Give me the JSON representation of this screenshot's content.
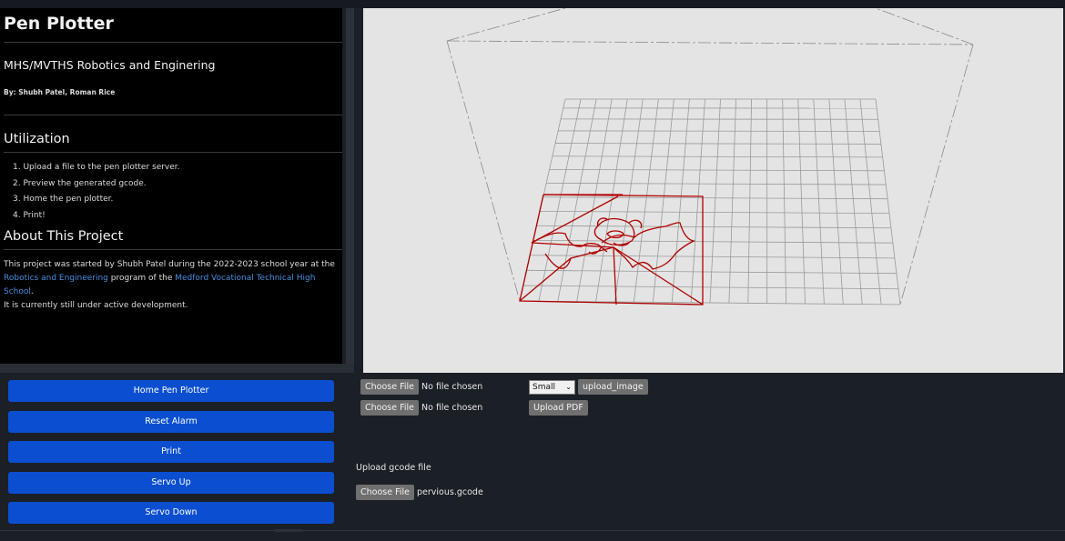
{
  "sidebar": {
    "title": "Pen Plotter",
    "subtitle": "MHS/MVTHS Robotics and Enginering",
    "byline": "By: Shubh Patel, Roman Rice",
    "utilization_heading": "Utilization",
    "steps": [
      "1. Upload a file to the pen plotter server.",
      "2. Preview the generated gcode.",
      "3. Home the pen plotter.",
      "4. Print!"
    ],
    "about_heading": "About This Project",
    "about_text_1": "This project was started by Shubh Patel during the 2022-2023 school year at the",
    "about_link_1": "Robotics and Engineering",
    "about_text_2": " program of the ",
    "about_link_2": "Medford Vocational Technical High School",
    "about_text_3": ".",
    "about_text_4": "It is currently still under active development.",
    "link_color": "#4a8fe0"
  },
  "controls": {
    "buttons": [
      "Home Pen Plotter",
      "Reset Alarm",
      "Print",
      "Servo Up",
      "Servo Down"
    ],
    "button_color": "#0b4fd0"
  },
  "uploads": {
    "image_choose": "Choose File",
    "image_status": "No file chosen",
    "size_value": "Small",
    "upload_image": "upload_image",
    "pdf_choose": "Choose File",
    "pdf_status": "No file chosen",
    "upload_pdf": "Upload PDF",
    "gcode_label": "Upload gcode file",
    "gcode_choose": "Choose File",
    "gcode_file": "pervious.gcode"
  },
  "viewer": {
    "background": "#e4e4e4",
    "grid_color": "#9a9a9a",
    "path_color": "#b00000"
  }
}
